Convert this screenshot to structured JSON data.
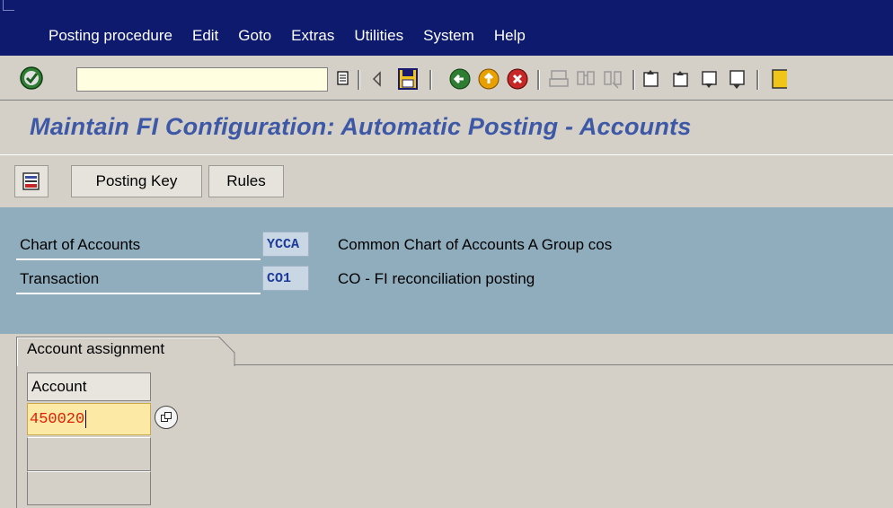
{
  "menu": {
    "items": [
      "Posting procedure",
      "Edit",
      "Goto",
      "Extras",
      "Utilities",
      "System",
      "Help"
    ]
  },
  "toolbar": {
    "command_field_value": "",
    "icons": [
      "enter-icon",
      "dropdown-icon",
      "back-arrow-icon",
      "save-icon",
      "back-icon",
      "exit-icon",
      "cancel-icon",
      "print-icon",
      "find-icon",
      "find-next-icon",
      "first-page-icon",
      "previous-page-icon",
      "next-page-icon",
      "last-page-icon"
    ]
  },
  "page": {
    "title": "Maintain FI Configuration: Automatic Posting - Accounts"
  },
  "app_toolbar": {
    "posting_key_label": "Posting Key",
    "rules_label": "Rules"
  },
  "header": {
    "chart_label": "Chart of Accounts",
    "chart_value": "YCCA",
    "chart_desc": "Common Chart of Accounts A Group cos",
    "transaction_label": "Transaction",
    "transaction_value": "CO1",
    "transaction_desc": "CO - FI reconciliation posting"
  },
  "tab": {
    "label": "Account assignment"
  },
  "table": {
    "column_header": "Account",
    "rows": [
      "450020",
      "",
      "",
      ""
    ]
  },
  "colors": {
    "menubar_bg": "#0d1a6e",
    "title_color": "#3d58a6",
    "header_bg": "#8fadbd",
    "input_highlight": "#fde9a6",
    "input_text": "#e02000"
  }
}
